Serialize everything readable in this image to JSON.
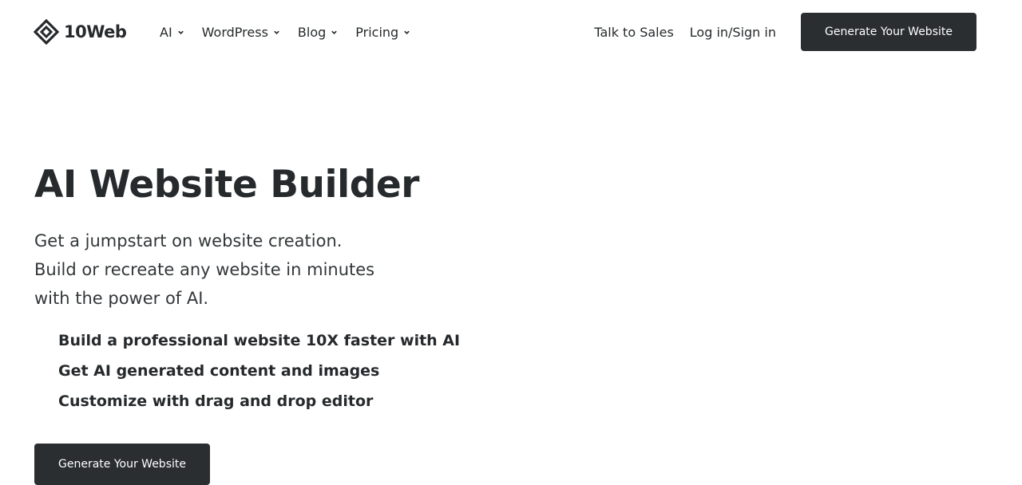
{
  "brand": {
    "name": "10Web",
    "logo_icon": "10web-diamond-logo-icon"
  },
  "nav": {
    "items": [
      {
        "label": "AI",
        "icon": "chevron-down-icon"
      },
      {
        "label": "WordPress",
        "icon": "chevron-down-icon"
      },
      {
        "label": "Blog",
        "icon": "chevron-down-icon"
      },
      {
        "label": "Pricing",
        "icon": "chevron-down-icon"
      }
    ],
    "talk_to_sales": "Talk to Sales",
    "login": "Log in/Sign in",
    "cta": "Generate Your Website"
  },
  "hero": {
    "title": "AI Website Builder",
    "subtitle_lines": [
      "Get a jumpstart on website creation.",
      "Build or recreate any website in minutes",
      "with the power of AI."
    ],
    "features": [
      "Build a professional website 10X faster with AI",
      "Get AI generated content and images",
      "Customize with drag and drop editor"
    ],
    "cta": "Generate Your Website"
  },
  "colors": {
    "text": "#262a2c",
    "button_bg": "#2a2e30",
    "button_text": "#ffffff",
    "background": "#ffffff"
  }
}
